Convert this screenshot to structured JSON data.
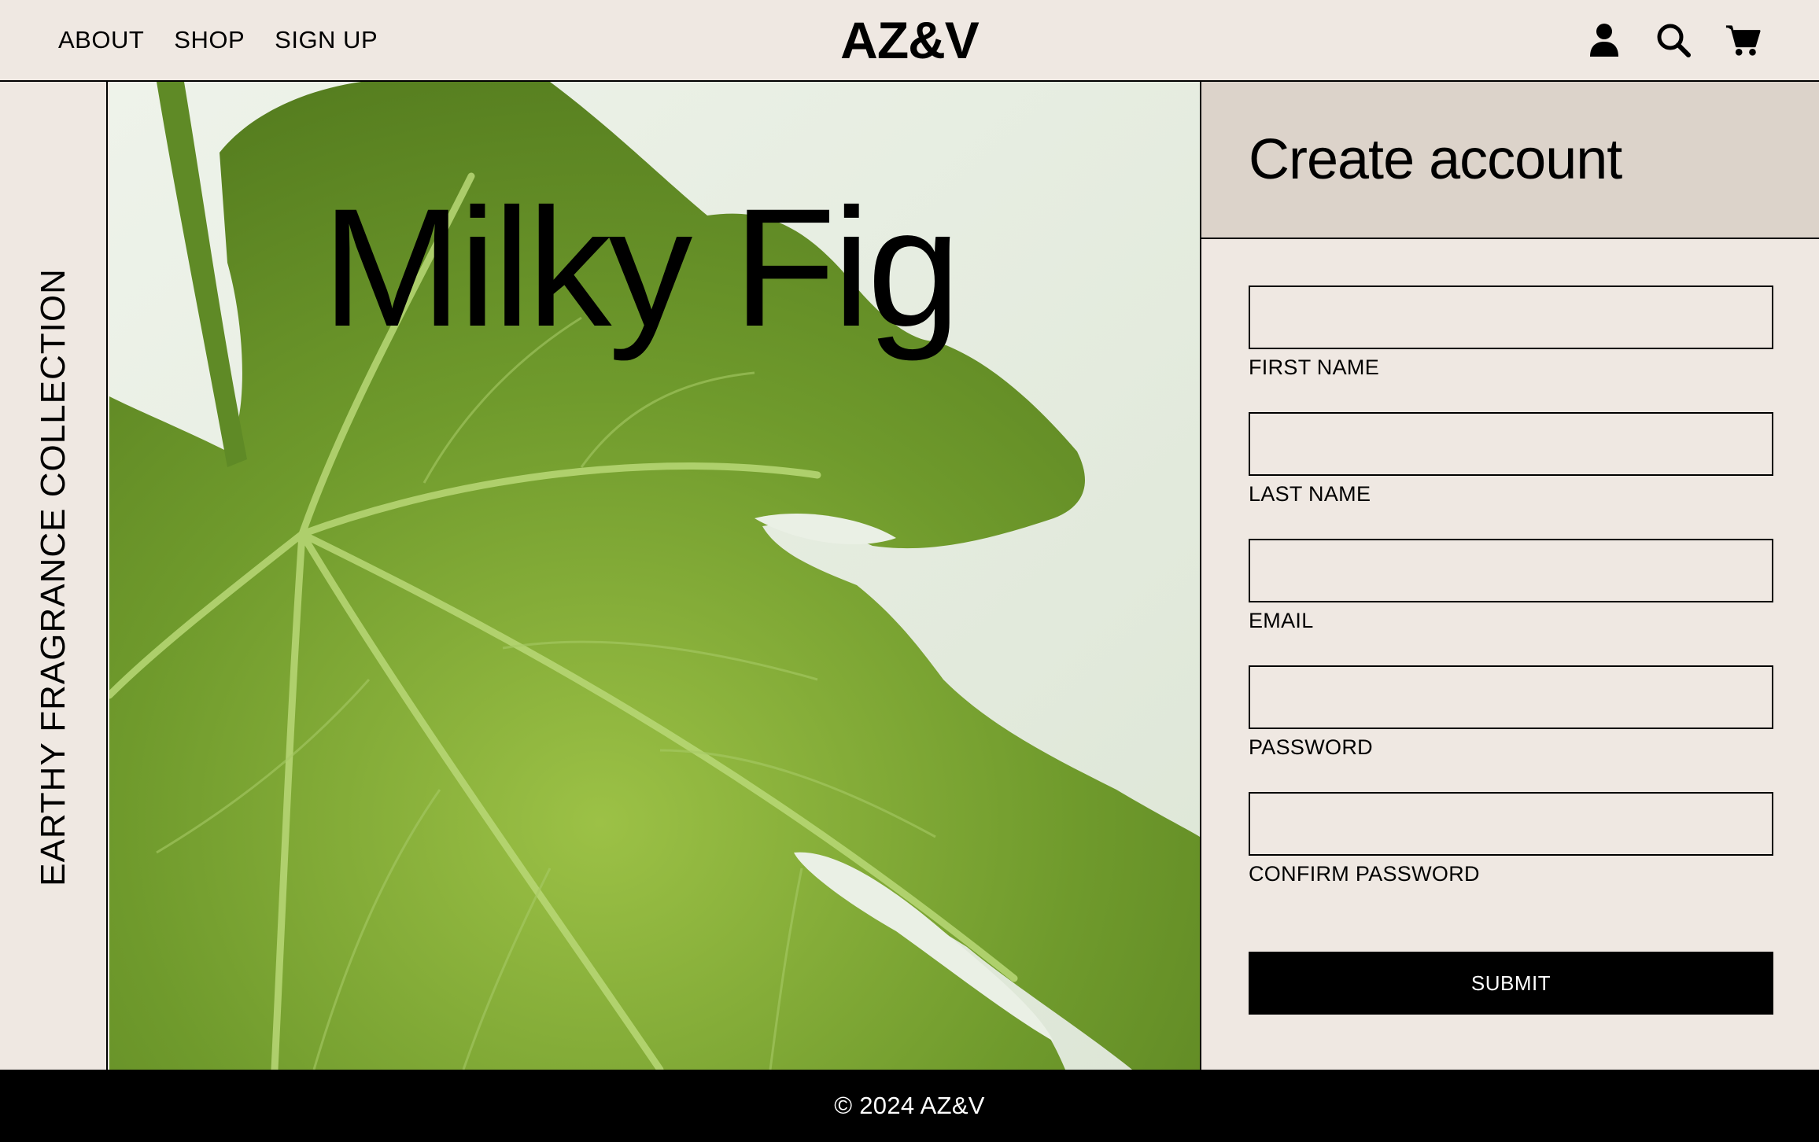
{
  "nav": {
    "about": "ABOUT",
    "shop": "SHOP",
    "sign_up": "SIGN UP"
  },
  "brand": "AZ&V",
  "header_icons": [
    "user-icon",
    "search-icon",
    "cart-icon"
  ],
  "side_label": "EARTHY FRAGRANCE COLLECTION",
  "hero": {
    "title": "Milky Fig"
  },
  "form": {
    "heading": "Create account",
    "fields": [
      {
        "label": "FIRST NAME",
        "value": ""
      },
      {
        "label": "LAST NAME",
        "value": ""
      },
      {
        "label": "EMAIL",
        "value": ""
      },
      {
        "label": "PASSWORD",
        "value": ""
      },
      {
        "label": "CONFIRM PASSWORD",
        "value": ""
      }
    ],
    "submit_label": "SUBMIT"
  },
  "footer": {
    "copyright": "© 2024 AZ&V"
  },
  "colors": {
    "background": "#efe8e2",
    "panel_header": "#dcd3ca",
    "leaf_green": "#6f9a2c",
    "footer": "#000000"
  }
}
